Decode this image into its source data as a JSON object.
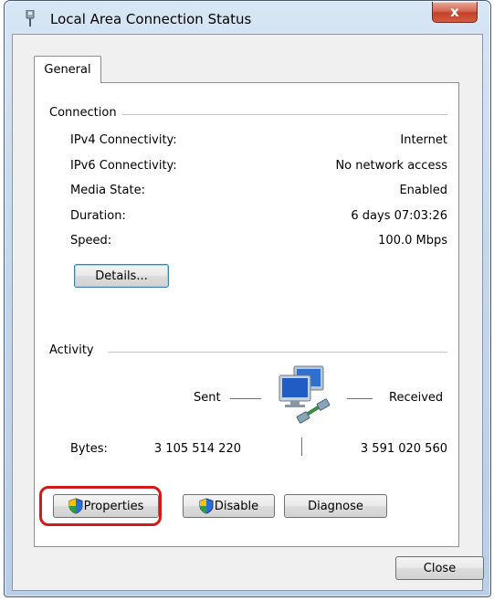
{
  "window": {
    "title": "Local Area Connection Status",
    "close_glyph": "x"
  },
  "tabs": [
    {
      "label": "General"
    }
  ],
  "connection": {
    "heading": "Connection",
    "rows": [
      {
        "label": "IPv4 Connectivity:",
        "value": "Internet"
      },
      {
        "label": "IPv6 Connectivity:",
        "value": "No network access"
      },
      {
        "label": "Media State:",
        "value": "Enabled"
      },
      {
        "label": "Duration:",
        "value": "6 days 07:03:26"
      },
      {
        "label": "Speed:",
        "value": "100.0 Mbps"
      }
    ],
    "details_button": "Details..."
  },
  "activity": {
    "heading": "Activity",
    "sent_label": "Sent",
    "received_label": "Received",
    "bytes_label": "Bytes:",
    "bytes_sent": "3 105 514 220",
    "bytes_received": "3 591 020 560"
  },
  "actions": {
    "properties": "Properties",
    "disable": "Disable",
    "diagnose": "Diagnose"
  },
  "footer": {
    "close": "Close"
  },
  "colors": {
    "highlight": "#d21a1a",
    "close_button": "#c3412a",
    "focus_border": "#3c7fb1"
  },
  "icons": {
    "title": "network-adapter-icon",
    "activity": "network-computers-icon",
    "shield": "uac-shield-icon"
  }
}
